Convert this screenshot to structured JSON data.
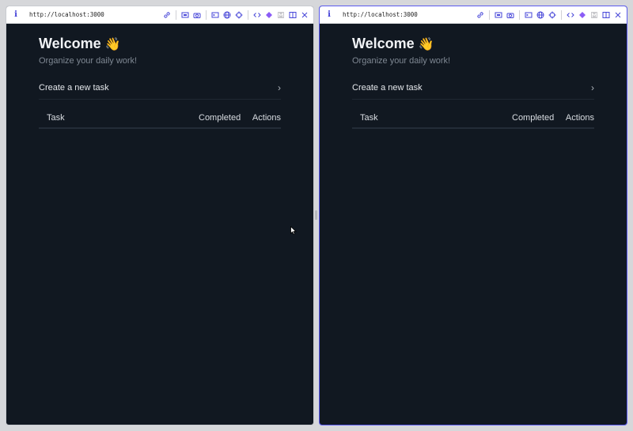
{
  "panes": [
    {
      "url": "http://localhost:3000",
      "title": "Welcome",
      "wave": "👋",
      "subtitle": "Organize your daily work!",
      "create_label": "Create a new task",
      "chevron": "›",
      "columns": {
        "task": "Task",
        "completed": "Completed",
        "actions": "Actions"
      }
    },
    {
      "url": "http://localhost:3000",
      "title": "Welcome",
      "wave": "👋",
      "subtitle": "Organize your daily work!",
      "create_label": "Create a new task",
      "chevron": "›",
      "columns": {
        "task": "Task",
        "completed": "Completed",
        "actions": "Actions"
      }
    }
  ],
  "toolbar_icons": [
    "info-icon",
    "link-icon",
    "screenshot-icon",
    "camera-icon",
    "terminal-icon",
    "globe-icon",
    "crosshair-icon",
    "code-icon",
    "gem-icon",
    "m-icon",
    "split-view-icon",
    "close-icon"
  ],
  "colors": {
    "accent": "#4645d8",
    "background": "#111821",
    "active_border": "#5b5bf0"
  }
}
